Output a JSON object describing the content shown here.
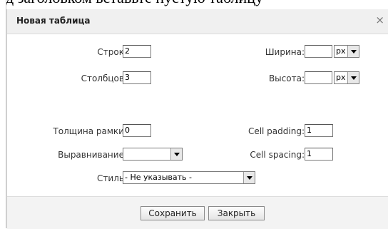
{
  "background_text": "д заголовком вставьте пустую таблицу",
  "dialog": {
    "title": "Новая таблица",
    "close_icon": "×",
    "rows_label": "Строк:",
    "rows_value": "2",
    "cols_label": "Столбцов:",
    "cols_value": "3",
    "width_label": "Ширина:",
    "width_value": "",
    "width_unit": "px",
    "height_label": "Высота:",
    "height_value": "",
    "height_unit": "px",
    "border_label": "Толщина рамки:",
    "border_value": "0",
    "padding_label": "Cell padding:",
    "padding_value": "1",
    "align_label": "Выравнивание:",
    "align_value": "",
    "spacing_label": "Cell spacing:",
    "spacing_value": "1",
    "style_label": "Стиль:",
    "style_value": "- Не указывать -",
    "save_label": "Сохранить",
    "close_label": "Закрыть"
  }
}
